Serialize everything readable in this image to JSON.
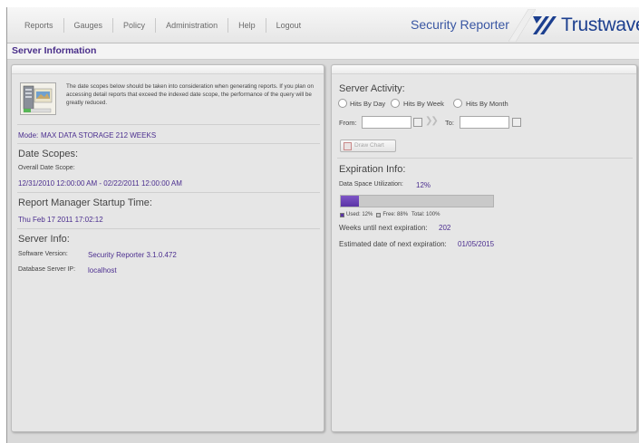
{
  "nav": {
    "items": [
      "Reports",
      "Gauges",
      "Policy",
      "Administration",
      "Help",
      "Logout"
    ]
  },
  "brand": {
    "product": "Security Reporter",
    "company": "Trustwave",
    "registered": "®",
    "colors": {
      "company": "#1c3f8f",
      "accent": "#4b2e8f"
    }
  },
  "page": {
    "title": "Server Information"
  },
  "left": {
    "icon": "server-info-icon",
    "notice": "The date scopes below should be taken into consideration when generating reports. If you plan on accessing detail reports that exceed the indexed date scope, the performance of the query will be greatly reduced.",
    "mode_label": "Mode:",
    "mode_value": "MAX DATA STORAGE 212 WEEKS",
    "date_scopes_heading": "Date Scopes:",
    "overall_label": "Overall Date Scope:",
    "overall_value": "12/31/2010 12:00:00 AM - 02/22/2011 12:00:00 AM",
    "startup_heading": "Report Manager Startup Time:",
    "startup_value": "Thu Feb 17 2011  17:02:12",
    "server_heading": "Server Info:",
    "software_label": "Software Version:",
    "software_value": "Security Reporter 3.1.0.472",
    "db_label": "Database Server IP:",
    "db_value": "localhost"
  },
  "right": {
    "activity_heading": "Server Activity:",
    "radios": [
      "Hits By Day",
      "Hits By Week",
      "Hits By Month"
    ],
    "from_label": "From:",
    "to_label": "To:",
    "draw_chart": "Draw Chart",
    "expiration_heading": "Expiration Info:",
    "utilization_label": "Data Space Utilization:",
    "utilization_value": "12%",
    "utilization_fraction": 0.12,
    "legend_used": "Used: 12%",
    "legend_free": "Free: 88%",
    "legend_total": "Total: 100%",
    "weeks_label": "Weeks until next expiration:",
    "weeks_value": "202",
    "est_label": "Estimated date of next expiration:",
    "est_value": "01/05/2015"
  }
}
